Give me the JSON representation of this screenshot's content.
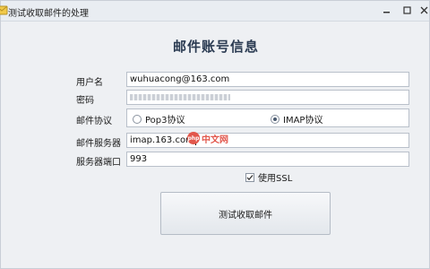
{
  "window": {
    "title": "测试收取邮件的处理",
    "icon": "mail-app-icon"
  },
  "form": {
    "heading": "邮件账号信息",
    "username_label": "用户名",
    "username_value": "wuhuacong@163.com",
    "password_label": "密码",
    "protocol_label": "邮件协议",
    "protocol_options": [
      "Pop3协议",
      "IMAP协议"
    ],
    "protocol_selected": "IMAP协议",
    "server_label": "邮件服务器",
    "server_value": "imap.163.com",
    "port_label": "服务器端口",
    "port_value": "993",
    "ssl_label": "使用SSL",
    "ssl_checked": true,
    "submit_label": "测试收取邮件"
  },
  "watermark": {
    "badge": "php",
    "text": "中文网",
    "color": "#e2574c"
  }
}
